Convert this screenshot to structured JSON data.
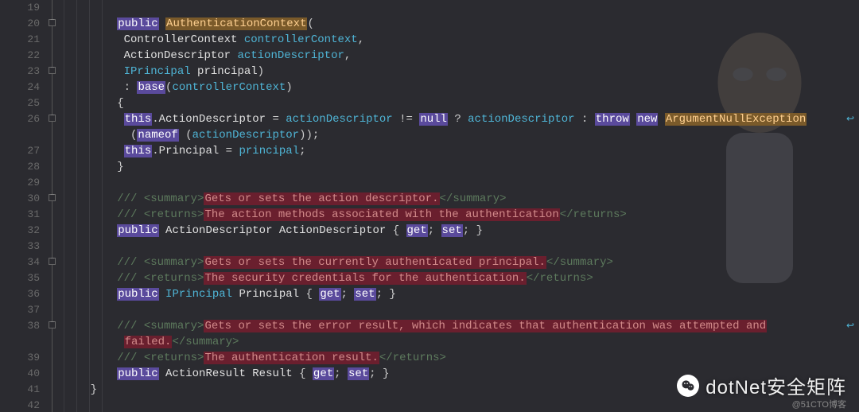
{
  "lines": [
    19,
    20,
    21,
    22,
    23,
    24,
    25,
    26,
    27,
    28,
    29,
    30,
    31,
    32,
    33,
    34,
    35,
    36,
    37,
    38,
    39,
    40,
    41,
    42
  ],
  "fold_boxes": [
    20,
    23,
    26,
    30,
    34,
    38
  ],
  "wrap_icons": [
    26,
    38
  ],
  "code": {
    "l20": {
      "kw": "public",
      "ctor": "AuthenticationContext",
      "tail": "("
    },
    "l21": {
      "type": "ControllerContext",
      "param": "controllerContext",
      "tail": ","
    },
    "l22": {
      "type": "ActionDescriptor",
      "param": "actionDescriptor",
      "tail": ","
    },
    "l23": {
      "type": "IPrincipal",
      "param": "principal",
      "tail": ")"
    },
    "l24": {
      "colon": ":",
      "kw": "base",
      "open": "(",
      "param": "controllerContext",
      "close": ")"
    },
    "l25": {
      "brace": "{"
    },
    "l26": {
      "this": "this",
      "dot": ".",
      "prop": "ActionDescriptor",
      "eq": " = ",
      "p1": "actionDescriptor",
      "neq": " != ",
      "null": "null",
      "q": " ? ",
      "p2": "actionDescriptor",
      "c": " : ",
      "throw": "throw",
      "new": "new",
      "exc": "ArgumentNullException"
    },
    "l26b": {
      "open": "(",
      "nameof": "nameof",
      "sp": " (",
      "param": "actionDescriptor",
      "close": "));"
    },
    "l27": {
      "this": "this",
      "dot": ".",
      "prop": "Principal",
      "eq": " = ",
      "param": "principal",
      "semi": ";"
    },
    "l28": {
      "brace": "}"
    },
    "l30": {
      "pre": "/// ",
      "open": "<summary>",
      "text": "Gets or sets the action descriptor.",
      "close": "</summary>"
    },
    "l31": {
      "pre": "/// ",
      "open": "<returns>",
      "text": "The action methods associated with the authentication",
      "close": "</returns>"
    },
    "l32": {
      "kw": "public",
      "type": "ActionDescriptor",
      "name": "ActionDescriptor",
      "body": " { ",
      "get": "get",
      "s1": "; ",
      "set": "set",
      "s2": "; }"
    },
    "l34": {
      "pre": "/// ",
      "open": "<summary>",
      "text": "Gets or sets the currently authenticated principal.",
      "close": "</summary>"
    },
    "l35": {
      "pre": "/// ",
      "open": "<returns>",
      "text": "The security credentials for the authentication.",
      "close": "</returns>"
    },
    "l36": {
      "kw": "public",
      "type": "IPrincipal",
      "name": "Principal",
      "body": " { ",
      "get": "get",
      "s1": "; ",
      "set": "set",
      "s2": "; }"
    },
    "l38": {
      "pre": "/// ",
      "open": "<summary>",
      "text": "Gets or sets the error result, which indicates that authentication was attempted and",
      "wrap": "failed.",
      "close": "</summary>"
    },
    "l39": {
      "pre": "/// ",
      "open": "<returns>",
      "text": "The authentication result.",
      "close": "</returns>"
    },
    "l40": {
      "kw": "public",
      "type": "ActionResult",
      "name": "Result",
      "body": " { ",
      "get": "get",
      "s1": "; ",
      "set": "set",
      "s2": "; }"
    },
    "l41": {
      "brace": "}"
    }
  },
  "watermark": {
    "text": "dotNet安全矩阵",
    "sub": "@51CTO博客"
  }
}
